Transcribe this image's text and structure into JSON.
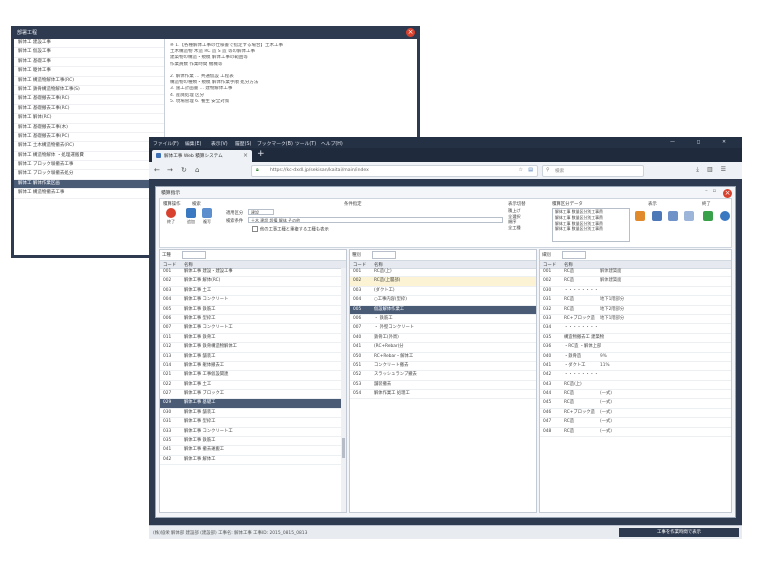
{
  "back_window": {
    "title": "部署工程",
    "items": [
      "解体工 建設工事",
      "解体工 仮設工事",
      "解体工 基礎工事",
      "解体工 躯体工事",
      "解体工 構造物解体工事(RC)",
      "解体工 鉄骨構造物解体工事(S)",
      "解体工 基礎撤去工事(RC)",
      "解体工 基礎撤去工事(RC)",
      "解体工 解体(RC)",
      "解体工 基礎撤去工事(木)",
      "解体工 基礎撤去工事(PC)",
      "解体工 土木構造物撤去(RC)",
      "解体工 構造物解体 ・処理運搬費",
      "解体工 ブロック塀撤去工事",
      "解体工 ブロック塀撤去処分",
      "解体工 解体作業区画",
      "解体工 構造物撤去工事"
    ],
    "selected_index": 15,
    "text_lines": [
      "※ 1.【各種解体工事の仕様書で指定する場合】土木工事",
      "土木構造物 木造 RC 造 S 造 等の解体工事",
      "建築物の構造・規模 解体工事の範囲等",
      "作業員数 作業時間 機械等",
      "",
      "2. 解体作業 ... 共通仮設 工程表",
      "  構造物の種類・規模 解体作業手順 処分方法",
      "3. 施工計画書 ... 建物解体工事",
      "4. 産廃処理 区分",
      "5. 現場管理    6. 養生 安全対策"
    ]
  },
  "browser": {
    "menu": [
      "ファイル(F)",
      "編集(E)",
      "表示(V)",
      "履歴(S)",
      "ブックマーク(B)",
      "ツール(T)",
      "ヘルプ(H)"
    ],
    "window_buttons": "—  ◻  ✕",
    "tab_label": "解体工事 Web 積算システム",
    "url": "https://kc-dxdl.jp/sekisan/kaitai/main/index",
    "search_placeholder": "検索"
  },
  "app": {
    "title": "積算指示",
    "ribbon": {
      "groups": [
        "積算操作",
        "検索",
        "条件指定",
        "表示切替",
        "積算区分データ",
        "表示",
        "終了"
      ],
      "btn_labels": [
        "終了",
        "追加",
        "複写",
        "追加",
        "削除",
        "検索"
      ],
      "field_labels": [
        "適用区分",
        "検索条件"
      ],
      "field_values": [
        "建設",
        "土木 建設 設備 解体 その他"
      ],
      "checkbox_label": "他の工事工種と重複する工種も表示",
      "options": [
        "積上げ",
        "全選択",
        "順序",
        "全工種"
      ],
      "list_items": [
        "解体工事 数量区分別工事費",
        "解体工事 数量区分別工事費",
        "解体工事 数量区分別工事費",
        "解体工事 数量区分別工事費"
      ]
    },
    "panel1": {
      "tab": "工種",
      "headers": [
        "コード",
        "名称"
      ],
      "rows": [
        [
          "001",
          "解体工事 建設・建設工事"
        ],
        [
          "002",
          "解体工事 解体(RC)"
        ],
        [
          "003",
          "解体工事 土工"
        ],
        [
          "004",
          "解体工事 コンクリート"
        ],
        [
          "005",
          "解体工事 鉄筋工"
        ],
        [
          "006",
          "解体工事 型枠工"
        ],
        [
          "007",
          "解体工事 コンクリート工"
        ],
        [
          "011",
          "解体工事 鉄骨工"
        ],
        [
          "012",
          "解体工事 鉄骨構造物解体工"
        ],
        [
          "013",
          "解体工事 舗装工"
        ],
        [
          "014",
          "解体工事 躯体撤去工"
        ],
        [
          "021",
          "解体工事 工事仮設関連"
        ],
        [
          "022",
          "解体工事 土工"
        ],
        [
          "027",
          "解体工事 ブロック工"
        ],
        [
          "029",
          "解体工事 基礎工"
        ],
        [
          "030",
          "解体工事 舗装工"
        ],
        [
          "031",
          "解体工事 型枠工"
        ],
        [
          "033",
          "解体工事 コンクリート工"
        ],
        [
          "035",
          "解体工事 鉄筋工"
        ],
        [
          "041",
          "解体工事 撤去運搬工"
        ],
        [
          "042",
          "解体工事 解体工"
        ]
      ],
      "selected_index": 14
    },
    "panel2": {
      "tab": "種別",
      "headers": [
        "コード",
        "名称"
      ],
      "rows": [
        [
          "001",
          "RC造(上)"
        ],
        [
          "002",
          "RC造(上層部)"
        ],
        [
          "003",
          "(ダクト工)"
        ],
        [
          "004",
          "○工事内容(型枠)"
        ],
        [
          "005",
          "仮設解体作業工"
        ],
        [
          "006",
          "・ 鉄筋工"
        ],
        [
          "007",
          "・ 外壁コンクリート"
        ],
        [
          "040",
          "鉄骨工(外周)"
        ],
        [
          "041",
          "(RC+Rebar)分"
        ],
        [
          "050",
          "RC+Rebar・解体工"
        ],
        [
          "051",
          "コンクリート撤去"
        ],
        [
          "052",
          "スラッシュランプ撤去"
        ],
        [
          "053",
          "舗装撤去"
        ],
        [
          "054",
          "解体作業工 処理工"
        ]
      ],
      "highlight_index": 1,
      "selected_index": 4
    },
    "panel3": {
      "tab": "細別",
      "headers": [
        "コード",
        "名称"
      ],
      "rows": [
        [
          "001",
          "RC造",
          "解体建築面"
        ],
        [
          "002",
          "RC造",
          "解体建築面"
        ],
        [
          "030",
          "・・・・・・・・",
          ""
        ],
        [
          "031",
          "RC造",
          "地下1階部分"
        ],
        [
          "032",
          "RC造",
          "地下2階部分"
        ],
        [
          "033",
          "RC+ブロック造",
          "地下1階部分"
        ],
        [
          "034",
          "・・・・・・・・",
          ""
        ],
        [
          "035",
          "構造物撤去工 建築物",
          ""
        ],
        [
          "036",
          "・RC造 ・解体上部",
          ""
        ],
        [
          "040",
          "・鉄骨造",
          "9%"
        ],
        [
          "041",
          "・ダクト工",
          "11%"
        ],
        [
          "042",
          "・・・・・・・・",
          ""
        ],
        [
          "043",
          "RC造(上)",
          ""
        ],
        [
          "044",
          "RC造",
          "(一式)"
        ],
        [
          "045",
          "RC造",
          "(一式)"
        ],
        [
          "046",
          "RC+ブロック造",
          "(一式)"
        ],
        [
          "047",
          "RC造",
          "(一式)"
        ],
        [
          "048",
          "RC造",
          "(一式)"
        ]
      ]
    },
    "status_text": "(株)協栄 解体部 建設部 (建設部) 工事名: 解体工事 工事ID: 2015_0815_0813",
    "status_button": "工事を作業時間で表示"
  },
  "colors": {
    "window_dark": "#2e3a4f",
    "selection": "#4a5b76",
    "close_red": "#d9412f",
    "highlight": "#fbf3d3"
  }
}
